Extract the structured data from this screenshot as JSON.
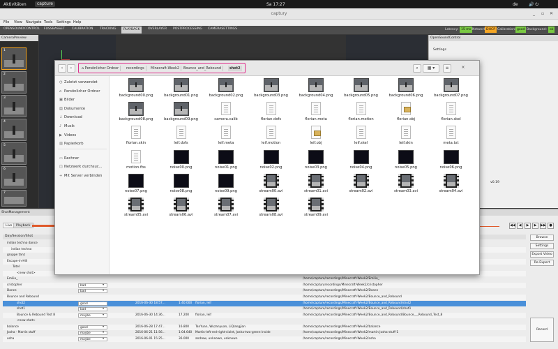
{
  "topbar": {
    "activities": "Aktivitäten",
    "app_name": "capture",
    "clock": "Sa 17:27",
    "lang": "de"
  },
  "window": {
    "title": "captury"
  },
  "menu": [
    "File",
    "View",
    "Navigate",
    "Tools",
    "Settings",
    "Help"
  ],
  "tabs": [
    "OPENSOUNDCONTROL",
    "FUSSBASSET",
    "CALIBRATION",
    "TRACKING",
    "PLAYBACK",
    "OVERLAYER",
    "POSTPROCESSING",
    "CAMERASETTINGS"
  ],
  "active_tab": "PLAYBACK",
  "status": {
    "latency_label": "Latency:",
    "latency_value": "15 ms",
    "network_label": "Network:",
    "network_value": "DHCP",
    "calibration_label": "Calibration:",
    "calibration_value": "good",
    "background_label": "Background:",
    "background_value": "ok"
  },
  "left_panel": {
    "title": "CameraPreview",
    "thumbs": [
      "1",
      "2",
      "3",
      "4",
      "5",
      "6",
      "7"
    ]
  },
  "right_panel": {
    "title": "OpenSoundControl",
    "settings_label": "Settings",
    "version": "v0.19"
  },
  "file_dialog": {
    "breadcrumbs": [
      "Persönlicher Ordner",
      "recordings",
      "Minecraft-Week2",
      "Bounce_and_Rebound",
      "shot2"
    ],
    "sidebar": [
      {
        "icon": "clock-icon",
        "glyph": "◷",
        "label": "Zuletzt verwendet"
      },
      {
        "icon": "home-icon",
        "glyph": "⌂",
        "label": "Persönlicher Ordner"
      },
      {
        "icon": "pictures-icon",
        "glyph": "▣",
        "label": "Bilder"
      },
      {
        "icon": "documents-icon",
        "glyph": "▤",
        "label": "Dokumente"
      },
      {
        "icon": "download-icon",
        "glyph": "↓",
        "label": "Download"
      },
      {
        "icon": "music-icon",
        "glyph": "♪",
        "label": "Musik"
      },
      {
        "icon": "videos-icon",
        "glyph": "▶",
        "label": "Videos"
      },
      {
        "icon": "trash-icon",
        "glyph": "▥",
        "label": "Papierkorb"
      },
      {
        "icon": "computer-icon",
        "glyph": "▭",
        "label": "Rechner"
      },
      {
        "icon": "network-icon",
        "glyph": "◫",
        "label": "Netzwerk durchsuc..."
      },
      {
        "icon": "server-icon",
        "glyph": "+",
        "label": "Mit Server verbinden"
      }
    ],
    "files": [
      {
        "name": "background00.png",
        "kind": "img"
      },
      {
        "name": "background01.png",
        "kind": "img"
      },
      {
        "name": "background02.png",
        "kind": "img"
      },
      {
        "name": "background03.png",
        "kind": "img"
      },
      {
        "name": "background04.png",
        "kind": "img"
      },
      {
        "name": "background05.png",
        "kind": "img"
      },
      {
        "name": "background06.png",
        "kind": "img"
      },
      {
        "name": "background07.png",
        "kind": "img"
      },
      {
        "name": "background08.png",
        "kind": "img"
      },
      {
        "name": "background09.png",
        "kind": "img"
      },
      {
        "name": "camera.calib",
        "kind": "doc"
      },
      {
        "name": "florian.dofs",
        "kind": "doc"
      },
      {
        "name": "florian.meta",
        "kind": "doc"
      },
      {
        "name": "florian.motion",
        "kind": "doc"
      },
      {
        "name": "florian.obj",
        "kind": "obj"
      },
      {
        "name": "florian.skel",
        "kind": "doc"
      },
      {
        "name": "florian.skin",
        "kind": "doc"
      },
      {
        "name": "leif.dofs",
        "kind": "doc"
      },
      {
        "name": "leif.meta",
        "kind": "doc"
      },
      {
        "name": "leif.motion",
        "kind": "doc"
      },
      {
        "name": "leif.obj",
        "kind": "obj"
      },
      {
        "name": "leif.skel",
        "kind": "doc"
      },
      {
        "name": "leif.skin",
        "kind": "doc"
      },
      {
        "name": "meta.txt",
        "kind": "doc"
      },
      {
        "name": "motion.fbs",
        "kind": "doc"
      },
      {
        "name": "noise00.png",
        "kind": "noise"
      },
      {
        "name": "noise01.png",
        "kind": "noise"
      },
      {
        "name": "noise02.png",
        "kind": "noise"
      },
      {
        "name": "noise03.png",
        "kind": "noise"
      },
      {
        "name": "noise04.png",
        "kind": "noise"
      },
      {
        "name": "noise05.png",
        "kind": "noise"
      },
      {
        "name": "noise06.png",
        "kind": "noise"
      },
      {
        "name": "noise07.png",
        "kind": "noise"
      },
      {
        "name": "noise08.png",
        "kind": "noise"
      },
      {
        "name": "noise09.png",
        "kind": "noise"
      },
      {
        "name": "stream00.avi",
        "kind": "vid"
      },
      {
        "name": "stream01.avi",
        "kind": "vid"
      },
      {
        "name": "stream02.avi",
        "kind": "vid"
      },
      {
        "name": "stream03.avi",
        "kind": "vid"
      },
      {
        "name": "stream04.avi",
        "kind": "vid"
      },
      {
        "name": "stream05.avi",
        "kind": "vid"
      },
      {
        "name": "stream06.avi",
        "kind": "vid"
      },
      {
        "name": "stream07.avi",
        "kind": "vid"
      },
      {
        "name": "stream08.avi",
        "kind": "vid"
      },
      {
        "name": "stream09.avi",
        "kind": "vid"
      }
    ]
  },
  "shot_management": {
    "title": "ShotManagement",
    "tab_live": "Live",
    "tab_playback": "Playback",
    "column": "Day/Session/Shot",
    "rows": [
      {
        "name": "indian techno dance",
        "status": "",
        "date": "",
        "duration": "",
        "actors": "",
        "path": "",
        "cls": ""
      },
      {
        "name": "indian techno",
        "status": "",
        "date": "",
        "duration": "",
        "actors": "",
        "path": "",
        "cls": "alt"
      },
      {
        "name": "gruppe tanz",
        "status": "",
        "date": "",
        "duration": "",
        "actors": "",
        "path": "",
        "cls": ""
      },
      {
        "name": "Escape-in-Hill",
        "status": "",
        "date": "",
        "duration": "",
        "actors": "",
        "path": "",
        "cls": "alt"
      },
      {
        "name": "Totel",
        "status": "",
        "date": "",
        "duration": "",
        "actors": "",
        "path": "",
        "cls": ""
      },
      {
        "name": "<new shot>",
        "status": "",
        "date": "",
        "duration": "",
        "actors": "",
        "path": "",
        "cls": "alt"
      },
      {
        "name": "Emilio_",
        "status": "",
        "date": "",
        "duration": "",
        "actors": "",
        "path": "/home/capture/recordings/Minecraft-Week2/Emilio_",
        "cls": ""
      },
      {
        "name": "cristopher",
        "status": "bad",
        "date": "",
        "duration": "",
        "actors": "",
        "path": "/home/capturyrecordings/Minecraft-Week2/cristopher",
        "cls": "alt"
      },
      {
        "name": "Dance",
        "status": "bad",
        "date": "",
        "duration": "",
        "actors": "",
        "path": "/home/capture/recordings/Minecraft-Week2/Dance",
        "cls": ""
      },
      {
        "name": "Bounce and Rebound",
        "status": "",
        "date": "",
        "duration": "",
        "actors": "",
        "path": "/home/capture/recordings/Minecraft-Week2/Bounce_and_Rebound",
        "cls": "alt"
      },
      {
        "name": "shot2",
        "status": "good",
        "date": "2016-06-30 18:57...",
        "duration": "1:40.000",
        "actors": "florian, leif",
        "path": "/home/capture/recordings/Minecraft-Week2/Bounce_and_Rebound/shot2",
        "cls": "sel"
      },
      {
        "name": "shot1",
        "status": "bad",
        "date": "",
        "duration": "",
        "actors": "",
        "path": "/home/capture/recordings/Minecraft-Week2/Bounce_and_Rebound/shot1",
        "cls": ""
      },
      {
        "name": "Bounce & Rebound Test 8",
        "status": "maybe",
        "date": "2016-06-30 14:36...",
        "duration": "17.200",
        "actors": "florian, leif",
        "path": "/home/capture/recordings/Minecraft-Week2/Bounce_and_Rebound/Bounce___Rebound_Test_8",
        "cls": "alt"
      },
      {
        "name": "<new shot>",
        "status": "",
        "date": "",
        "duration": "",
        "actors": "",
        "path": "",
        "cls": ""
      },
      {
        "name": "balance",
        "status": "good",
        "date": "2016-06-28 17:47...",
        "duration": "16.800",
        "actors": "TanYuan, Wuzanyuan, LiQiangjian",
        "path": "/home/capture/recordings/Minecraft-Week2/balance",
        "cls": "alt"
      },
      {
        "name": "Josha - Martin stuff",
        "status": "maybe",
        "date": "2016-06-21 11:56...",
        "duration": "1:04.640",
        "actors": "Martin-left-red-right-violet, Josha-two-green-inside",
        "path": "/home/capture/recordings/Minecraft-Week2/martin-josha-stuff-1",
        "cls": ""
      },
      {
        "name": "osha",
        "status": "maybe",
        "date": "2016-06-01 15:25...",
        "duration": "36.000",
        "actors": "andrew, unknown, unknown",
        "path": "/home/capture/recordings/Minecraft-Week2/osha",
        "cls": "alt"
      }
    ],
    "buttons": [
      "Browse",
      "Settings",
      "Export Video",
      "Re-Export"
    ],
    "record": "Record"
  }
}
